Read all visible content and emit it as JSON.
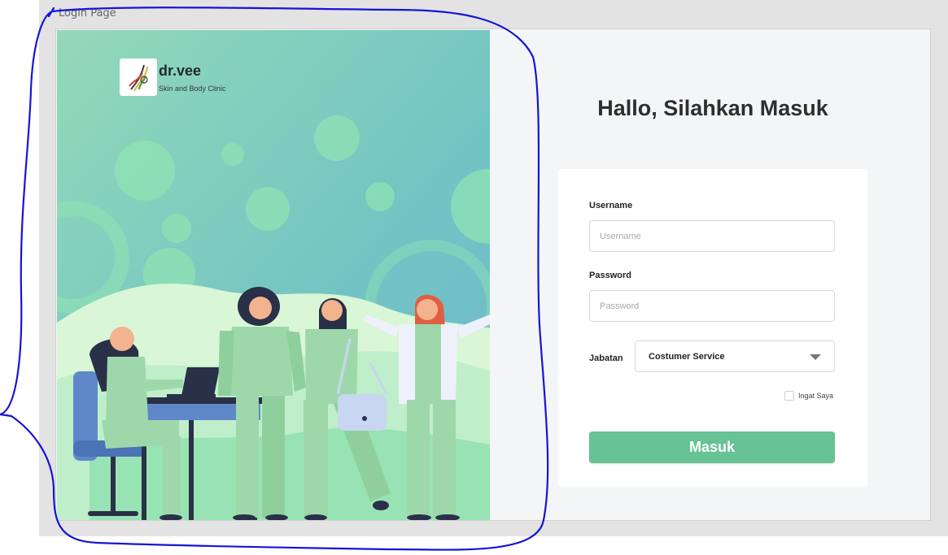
{
  "page_label": "Login Page",
  "brand": {
    "name": "dr.vee",
    "tagline": "Skin and Body Clinic"
  },
  "heading": "Hallo, Silahkan Masuk",
  "form": {
    "username_label": "Username",
    "username_placeholder": "Username",
    "password_label": "Password",
    "password_placeholder": "Password",
    "jabatan_label": "Jabatan",
    "jabatan_value": "Costumer Service",
    "remember_label": "Ingat Saya",
    "submit_label": "Masuk"
  },
  "colors": {
    "accent": "#67c294",
    "annotation": "#1515d6"
  }
}
